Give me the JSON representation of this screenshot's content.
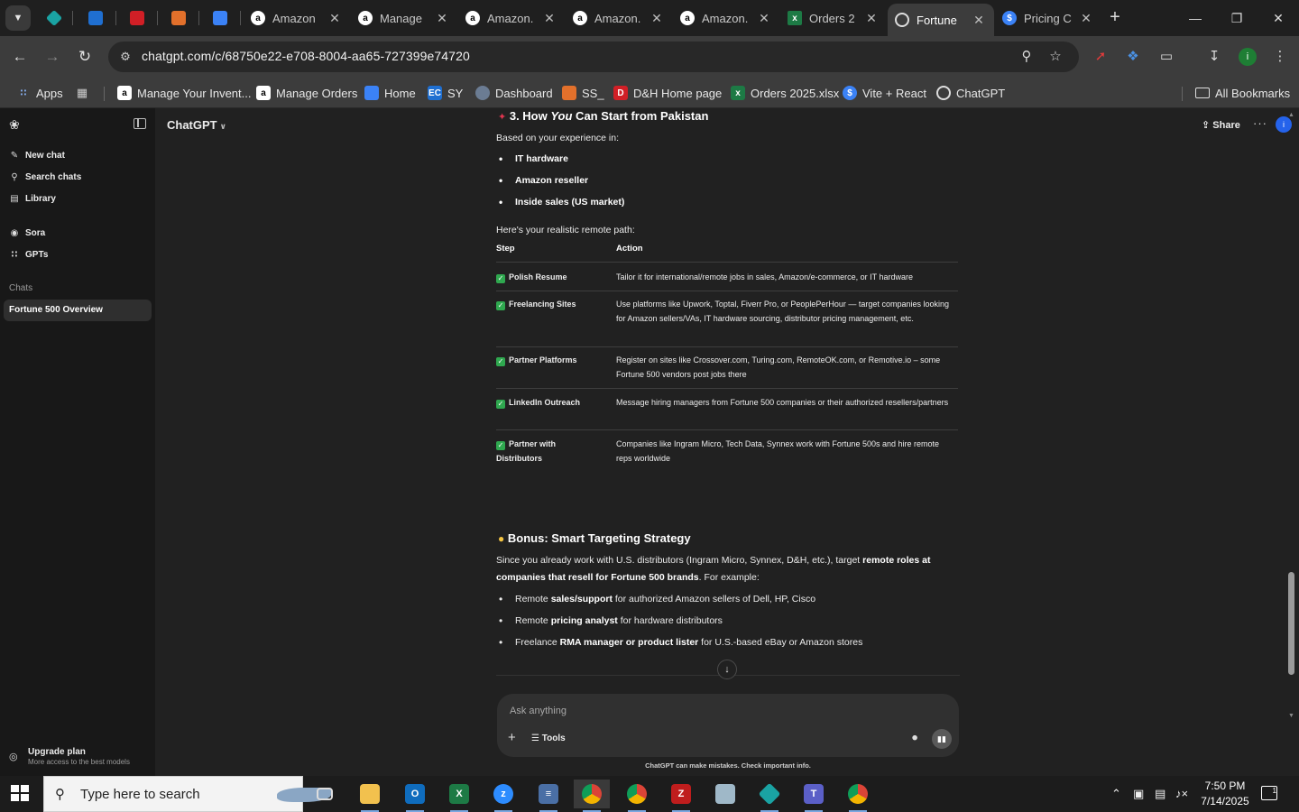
{
  "browser": {
    "pinned_tabs": [
      {
        "icon": "teal-diamond-icon",
        "color": "#1aa3a3"
      },
      {
        "icon": "ec-logo-icon",
        "color": "#1f6fd1"
      },
      {
        "icon": "dh-logo-icon",
        "color": "#d11f26"
      },
      {
        "icon": "stack-icon",
        "color": "#e2702b"
      },
      {
        "icon": "doc-icon",
        "color": "#3b82f6"
      }
    ],
    "tabs": [
      {
        "title": "Amazon",
        "icon": "amazon-icon"
      },
      {
        "title": "Manage",
        "icon": "amazon-icon"
      },
      {
        "title": "Amazon.",
        "icon": "amazon-icon"
      },
      {
        "title": "Amazon.",
        "icon": "amazon-icon"
      },
      {
        "title": "Amazon.",
        "icon": "amazon-icon"
      },
      {
        "title": "Orders 2",
        "icon": "excel-icon"
      },
      {
        "title": "Fortune",
        "icon": "chatgpt-icon",
        "active": true
      },
      {
        "title": "Pricing C",
        "icon": "dollar-icon"
      }
    ],
    "url": "chatgpt.com/c/68750e22-e708-8004-aa65-727399e74720",
    "profile_initial": "i",
    "bookmarks": [
      {
        "label": "Apps",
        "icon": "apps-grid-icon"
      },
      {
        "label": "",
        "icon": "tab-groups-icon"
      },
      {
        "label": "Manage Your Invent...",
        "icon": "amazon-icon"
      },
      {
        "label": "Manage Orders",
        "icon": "amazon-icon"
      },
      {
        "label": "Home",
        "icon": "blue-doc-icon"
      },
      {
        "label": "SY",
        "icon": "ec-logo-icon"
      },
      {
        "label": "Dashboard",
        "icon": "dashboard-icon"
      },
      {
        "label": "SS_",
        "icon": "stack-icon"
      },
      {
        "label": "D&H Home page",
        "icon": "dh-logo-icon"
      },
      {
        "label": "Orders 2025.xlsx",
        "icon": "excel-icon"
      },
      {
        "label": "Vite + React",
        "icon": "dollar-icon"
      },
      {
        "label": "ChatGPT",
        "icon": "chatgpt-icon"
      }
    ],
    "all_bookmarks": "All Bookmarks"
  },
  "sidebar": {
    "items": [
      {
        "label": "New chat",
        "icon": "edit-icon"
      },
      {
        "label": "Search chats",
        "icon": "search-icon"
      },
      {
        "label": "Library",
        "icon": "library-icon"
      },
      {
        "label": "Sora",
        "icon": "sora-icon"
      },
      {
        "label": "GPTs",
        "icon": "gpts-icon"
      }
    ],
    "chats_heading": "Chats",
    "active_chat": "Fortune 500 Overview",
    "upgrade_title": "Upgrade plan",
    "upgrade_subtitle": "More access to the best models"
  },
  "header": {
    "model": "ChatGPT",
    "share": "Share",
    "avatar_initial": "i"
  },
  "message": {
    "section3_title_pre": "3. How ",
    "section3_title_em": "You",
    "section3_title_post": " Can Start from Pakistan",
    "experience_intro": "Based on your experience in:",
    "experience": [
      "IT hardware",
      "Amazon reseller",
      "Inside sales (US market)"
    ],
    "path_intro": "Here's your realistic remote path:",
    "table_headers": [
      "Step",
      "Action"
    ],
    "table_rows": [
      {
        "step": "Polish Resume",
        "action": "Tailor it for international/remote jobs in sales, Amazon/e-commerce, or IT hardware"
      },
      {
        "step": "Freelancing Sites",
        "action": "Use platforms like Upwork, Toptal, Fiverr Pro, or PeoplePerHour — target companies looking for Amazon sellers/VAs, IT hardware sourcing, distributor pricing management, etc."
      },
      {
        "step": "Partner Platforms",
        "action": "Register on sites like Crossover.com, Turing.com, RemoteOK.com, or Remotive.io – some Fortune 500 vendors post jobs there"
      },
      {
        "step": "LinkedIn Outreach",
        "action": "Message hiring managers from Fortune 500 companies or their authorized resellers/partners"
      },
      {
        "step": "Partner with Distributors",
        "action": "Companies like Ingram Micro, Tech Data, Synnex work with Fortune 500s and hire remote reps worldwide"
      }
    ],
    "bonus_title": "Bonus: Smart Targeting Strategy",
    "bonus_p1": "Since you already work with U.S. distributors (Ingram Micro, Synnex, D&H, etc.), target ",
    "bonus_b1": "remote roles at companies that resell for Fortune 500 brands",
    "bonus_p2": ". For example:",
    "bonus_items": [
      {
        "pre": "Remote ",
        "bold": "sales/support",
        "post": " for authorized Amazon sellers of Dell, HP, Cisco"
      },
      {
        "pre": "Remote ",
        "bold": "pricing analyst",
        "post": " for hardware distributors"
      },
      {
        "pre": "Freelance ",
        "bold": "RMA manager or product lister",
        "post": " for U.S.-based eBay or Amazon stores"
      }
    ]
  },
  "composer": {
    "placeholder": "Ask anything",
    "tools": "Tools",
    "disclaimer": "ChatGPT can make mistakes. Check important info."
  },
  "taskbar": {
    "search_placeholder": "Type here to search",
    "time": "7:50 PM",
    "date": "7/14/2025",
    "notifications": "1"
  }
}
